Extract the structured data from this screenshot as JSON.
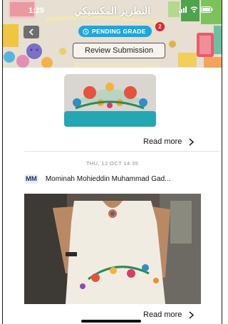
{
  "status_bar": {
    "time": "1:29",
    "app_title": "التطريز المكسيكي"
  },
  "header": {
    "back_icon": "chevron-left-icon",
    "status_label": "PENDING GRADE",
    "status_icon": "clock-icon",
    "notification_count": "2",
    "review_button_label": "Review Submission",
    "colors": {
      "status_pill": "#1ba7e0",
      "badge": "#e3262f"
    }
  },
  "posts": [
    {
      "image": "embroidered-pillow",
      "read_more_label": "Read more",
      "chevron": "chevron-right-icon"
    },
    {
      "date": "THU, 12 OCT 14:35",
      "avatar_initials": "MM",
      "author": "Mominah Mohieddin Muhammad Gad...",
      "image": "embroidered-blouse",
      "read_more_label": "Read more",
      "chevron": "chevron-right-icon"
    }
  ]
}
